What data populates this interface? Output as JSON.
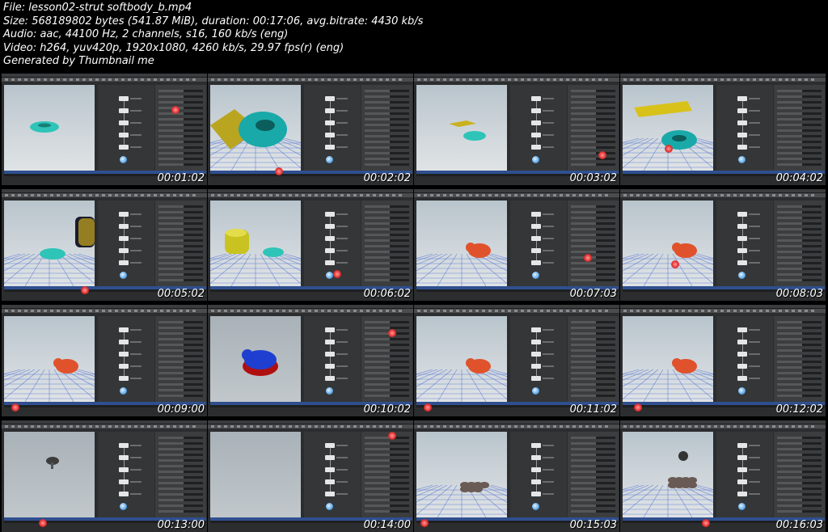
{
  "header": {
    "file": "File: lesson02-strut softbody_b.mp4",
    "size": "Size: 568189802 bytes (541.87 MiB), duration: 00:17:06, avg.bitrate: 4430 kb/s",
    "audio": "Audio: aac, 44100 Hz, 2 channels, s16, 160 kb/s (eng)",
    "video": "Video: h264, yuv420p, 1920x1080, 4260 kb/s, 29.97 fps(r) (eng)",
    "generator": "Generated by Thumbnail me"
  },
  "thumbnails": [
    {
      "timestamp": "00:01:02",
      "scene": "torus-only",
      "color": "#2fc4b8"
    },
    {
      "timestamp": "00:02:02",
      "scene": "torus-plane",
      "color": "#1aa9a9"
    },
    {
      "timestamp": "00:03:02",
      "scene": "torus-plane-far",
      "color": "#2fc4b8"
    },
    {
      "timestamp": "00:04:02",
      "scene": "torus-plane-close",
      "color": "#1aa9a9"
    },
    {
      "timestamp": "00:05:02",
      "scene": "torus-cylinder-side",
      "color": "#2fc4b8"
    },
    {
      "timestamp": "00:06:02",
      "scene": "torus-cylinder",
      "color": "#2fc4b8"
    },
    {
      "timestamp": "00:07:03",
      "scene": "pig",
      "color": "#e0522c"
    },
    {
      "timestamp": "00:08:03",
      "scene": "pig",
      "color": "#e0522c"
    },
    {
      "timestamp": "00:09:00",
      "scene": "pig",
      "color": "#e0522c"
    },
    {
      "timestamp": "00:10:02",
      "scene": "pig-blue",
      "color": "#1f3fd0"
    },
    {
      "timestamp": "00:11:02",
      "scene": "pig",
      "color": "#e0522c"
    },
    {
      "timestamp": "00:12:02",
      "scene": "pig",
      "color": "#e0522c"
    },
    {
      "timestamp": "00:13:00",
      "scene": "mushroom",
      "color": "#555555"
    },
    {
      "timestamp": "00:14:00",
      "scene": "empty",
      "color": "#999999"
    },
    {
      "timestamp": "00:15:03",
      "scene": "debris",
      "color": "#6a5a55"
    },
    {
      "timestamp": "00:16:03",
      "scene": "debris-fall",
      "color": "#6a5a55"
    }
  ]
}
